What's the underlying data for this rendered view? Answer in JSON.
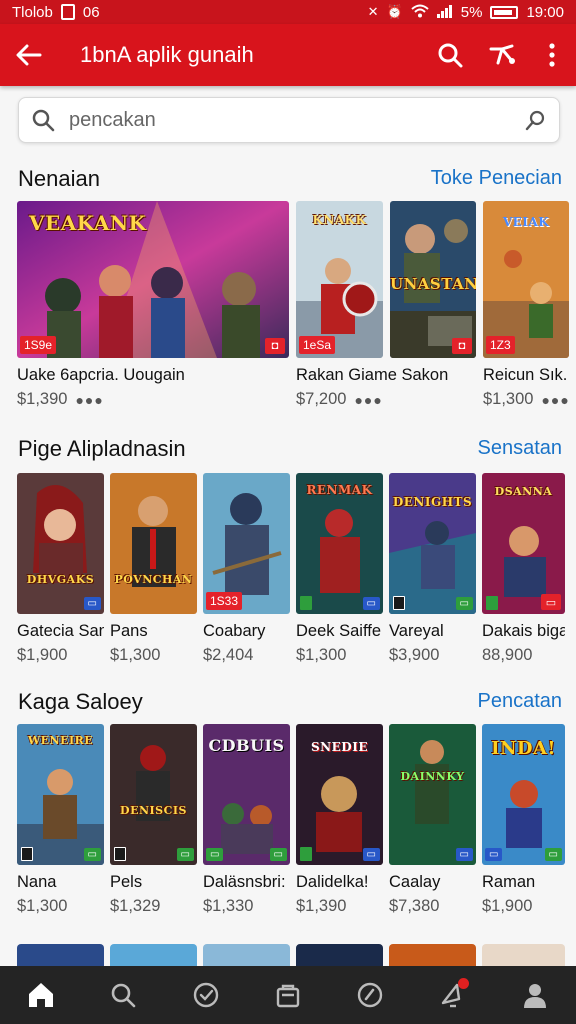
{
  "status_bar": {
    "left_text": "Tlolob",
    "left_num": "06",
    "battery": "5%",
    "time": "19:00"
  },
  "app_bar": {
    "title": "1bnA aplik gunaih"
  },
  "search": {
    "placeholder": "pencakan"
  },
  "sections": [
    {
      "title": "Nenaian",
      "link": "Toke Penecian",
      "items": [
        {
          "name": "Uake 6apcria. Uougain",
          "price": "$1,390",
          "badge": "1S9e",
          "art": "VEAKANK"
        },
        {
          "name": "Rakan Giame Sakon",
          "price": "$7,200",
          "badge": "1eSa",
          "art": "KNAKK"
        },
        {
          "name": "",
          "price": "",
          "badge": "",
          "art": "UNASTAN"
        },
        {
          "name": "Reicun Sık.",
          "price": "$1,300",
          "badge": "1Z3",
          "art": "VEIAK"
        }
      ]
    },
    {
      "title": "Pige Alipladnasin",
      "link": "Sensatan",
      "items": [
        {
          "name": "Gatecia San",
          "price": "$1,900",
          "art": "DHVGAKS"
        },
        {
          "name": "Pans",
          "price": "$1,300",
          "art": "POVNCHAN"
        },
        {
          "name": "Coabary",
          "price": "$2,404",
          "badge": "1S33",
          "art": ""
        },
        {
          "name": "Deek Saiffe",
          "price": "$1,300",
          "art": "RENMAK"
        },
        {
          "name": "Vareyal",
          "price": "$3,900",
          "art": "DENIGHTS"
        },
        {
          "name": "Dakais biga",
          "price": "88,900",
          "art": "DSANNA"
        }
      ]
    },
    {
      "title": "Kaga Saloey",
      "link": "Pencatan",
      "items": [
        {
          "name": "Nana",
          "price": "$1,300",
          "art": "WENEIRE"
        },
        {
          "name": "Pels",
          "price": "$1,329",
          "art": "DENISCIS"
        },
        {
          "name": "Daläsnsbri:",
          "price": "$1,330",
          "art": "CDBUIS"
        },
        {
          "name": "Dalidelka!",
          "price": "$1,390",
          "art": "SNEDIE"
        },
        {
          "name": "Caalay",
          "price": "$7,380",
          "art": "DAINNKY"
        },
        {
          "name": "Raman",
          "price": "$1,900",
          "art": "INDA!"
        }
      ]
    }
  ],
  "bottom_nav": [
    {
      "icon": "home-icon"
    },
    {
      "icon": "search-icon"
    },
    {
      "icon": "clock-icon"
    },
    {
      "icon": "bag-icon"
    },
    {
      "icon": "compass-icon"
    },
    {
      "icon": "bell-icon"
    },
    {
      "icon": "profile-icon"
    }
  ]
}
